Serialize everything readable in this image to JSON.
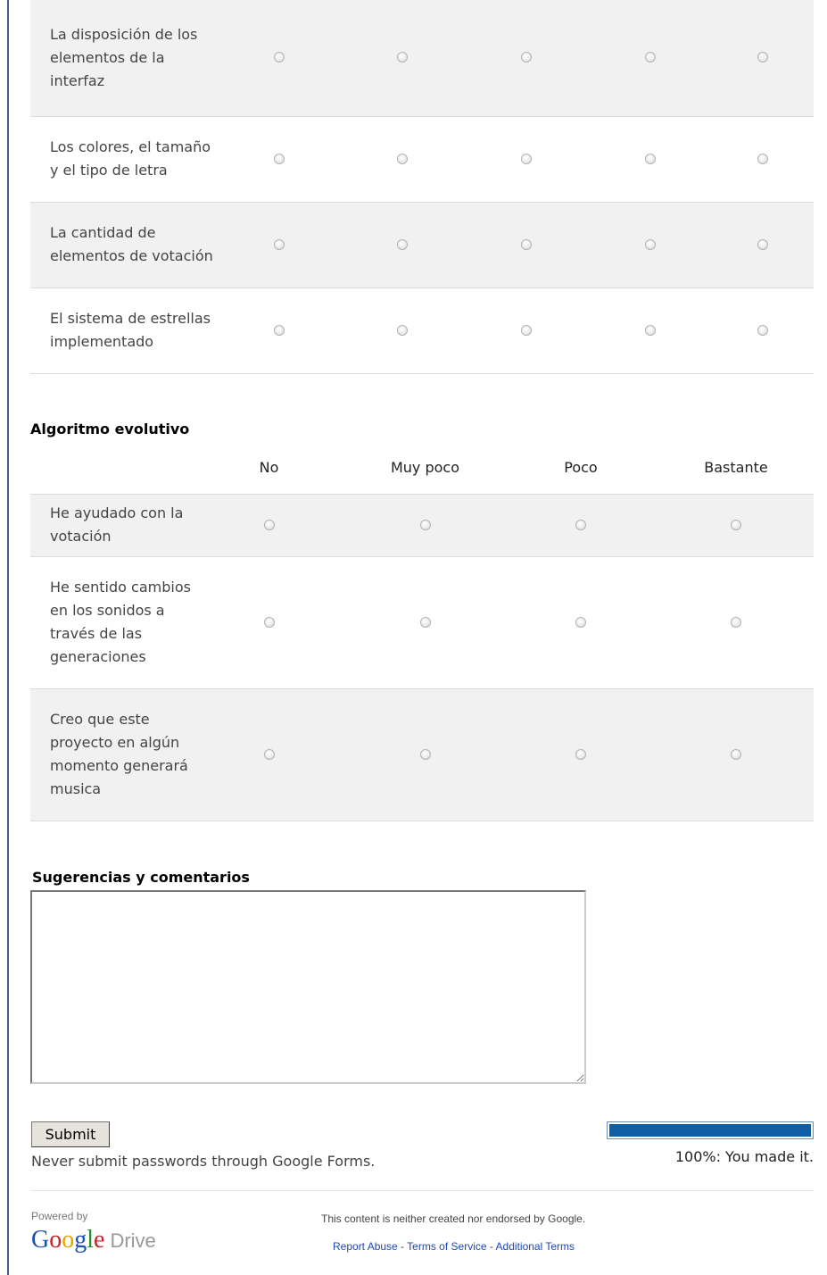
{
  "grid1": {
    "rows": [
      {
        "label": "La disposición de los elementos de la interfaz"
      },
      {
        "label": "Los colores, el tamaño y el tipo de letra"
      },
      {
        "label": "La cantidad de elementos de votación"
      },
      {
        "label": "El sistema de estrellas implementado"
      }
    ]
  },
  "grid2": {
    "title": "Algoritmo evolutivo",
    "columns": [
      "No",
      "Muy poco",
      "Poco",
      "Bastante"
    ],
    "rows": [
      {
        "label": "He ayudado con la votación"
      },
      {
        "label": "He sentido cambios en los sonidos a través de las generaciones"
      },
      {
        "label": "Creo que este proyecto en algún momento generará musica"
      }
    ]
  },
  "comments": {
    "title": "Sugerencias y comentarios",
    "value": ""
  },
  "submit": {
    "label": "Submit",
    "note": "Never submit passwords through Google Forms."
  },
  "progress": {
    "percent": 100,
    "text": "100%: You made it."
  },
  "footer": {
    "powered_by": "Powered by",
    "logo_drive": "Drive",
    "disclaimer": "This content is neither created nor endorsed by Google.",
    "link_report": "Report Abuse",
    "link_terms": "Terms of Service",
    "link_additional": "Additional Terms",
    "separator": " - "
  },
  "colors": {
    "progress_fill": "#0f5da4",
    "border_accent": "#3c5f8f",
    "row_alt": "#f1f1f1"
  }
}
